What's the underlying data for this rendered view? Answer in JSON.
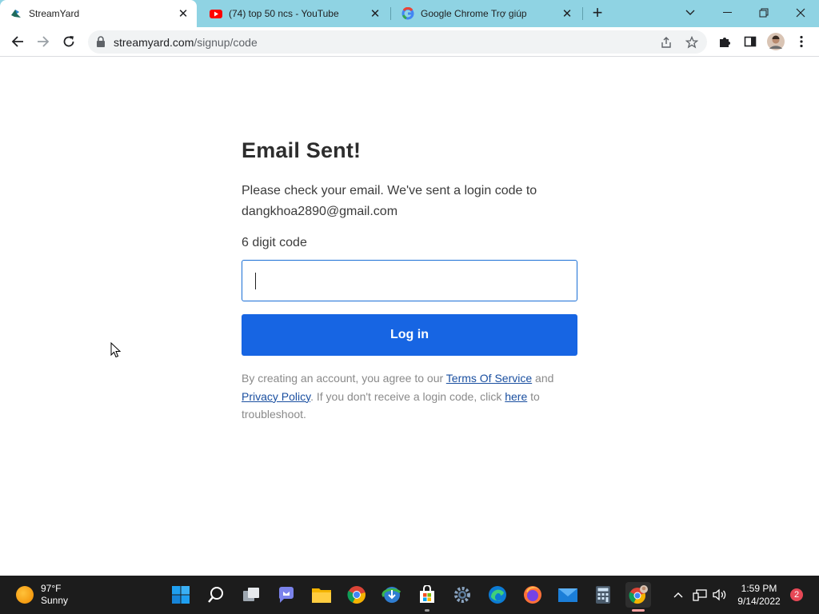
{
  "browser": {
    "tabs": [
      {
        "title": "StreamYard",
        "active": true
      },
      {
        "title": "(74) top 50 ncs - YouTube",
        "active": false
      },
      {
        "title": "Google Chrome Trợ giúp",
        "active": false
      }
    ],
    "url_host": "streamyard.com",
    "url_path": "/signup/code"
  },
  "page": {
    "heading": "Email Sent!",
    "description": "Please check your email. We've sent a login code to dangkhoa2890@gmail.com",
    "code_label": "6 digit code",
    "code_value": "",
    "login_label": "Log in",
    "terms": {
      "prefix": "By creating an account, you agree to our ",
      "tos_link": "Terms Of Service",
      "and": " and ",
      "privacy_link": "Privacy Policy",
      "middle": ". If you don't receive a login code, click ",
      "here_link": "here",
      "suffix": " to troubleshoot."
    }
  },
  "taskbar": {
    "weather_temp": "97°F",
    "weather_desc": "Sunny",
    "time": "1:59 PM",
    "date": "9/14/2022",
    "notification_count": "2"
  },
  "colors": {
    "tabstrip": "#8fd3e3",
    "primary_button": "#1765e3",
    "link": "#1a4fa0",
    "taskbar": "#1c1c1c"
  }
}
